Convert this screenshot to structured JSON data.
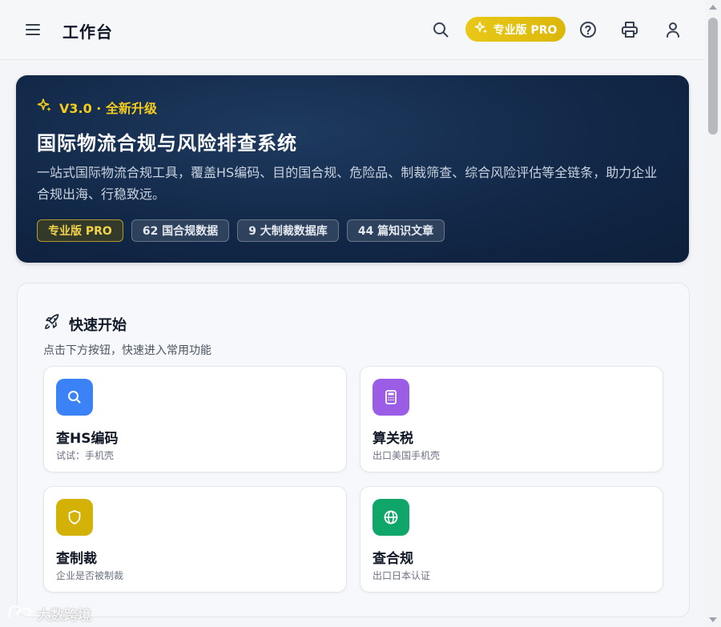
{
  "header": {
    "title": "工作台",
    "pro_button_label": "专业版 PRO",
    "icons": [
      "menu-icon",
      "search-icon",
      "help-icon",
      "print-icon",
      "user-icon"
    ]
  },
  "hero": {
    "badge": "V3.0 · 全新升级",
    "title": "国际物流合规与风险排查系统",
    "description": "一站式国际物流合规工具，覆盖HS编码、目的国合规、危险品、制裁筛查、综合风险评估等全链条，助力企业合规出海、行稳致远。",
    "tags": [
      "专业版 PRO",
      "62 国合规数据",
      "9 大制裁数据库",
      "44 篇知识文章"
    ]
  },
  "quick_start": {
    "title": "快速开始",
    "subtitle": "点击下方按钮，快速进入常用功能",
    "cards": [
      {
        "title": "查HS编码",
        "subtitle": "试试：手机壳",
        "icon": "search-icon",
        "color": "#3b82f6"
      },
      {
        "title": "算关税",
        "subtitle": "出口美国手机壳",
        "icon": "calculator-icon",
        "color": "#9b5de5"
      },
      {
        "title": "查制裁",
        "subtitle": "企业是否被制裁",
        "icon": "shield-icon",
        "color": "#d4b106"
      },
      {
        "title": "查合规",
        "subtitle": "出口日本认证",
        "icon": "globe-icon",
        "color": "#10a66a"
      }
    ]
  },
  "watermark": "大数跨境",
  "colors": {
    "accent": "#e2c011",
    "hero_bg": "#122848"
  }
}
